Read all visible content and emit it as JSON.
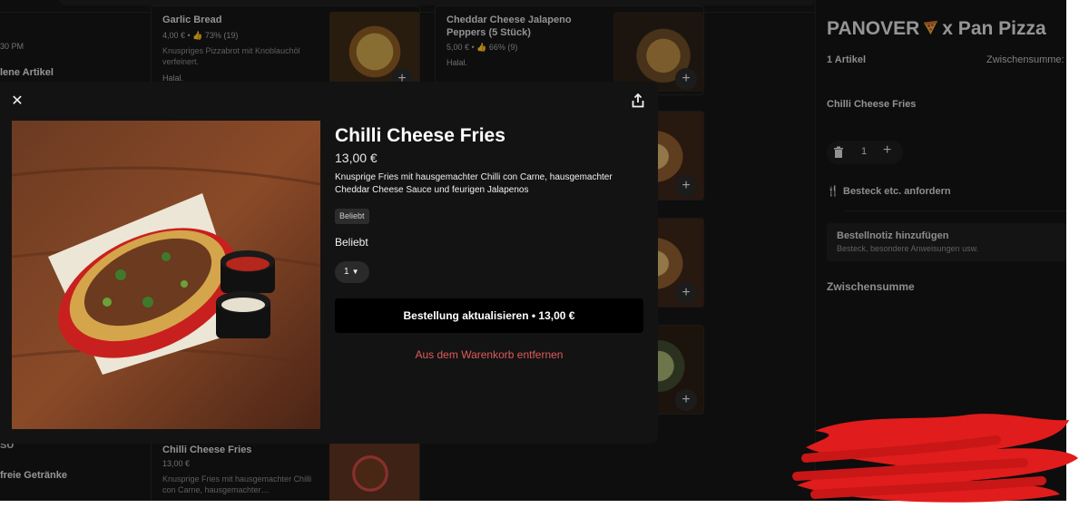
{
  "background": {
    "left_column": {
      "time_fragment": "30 PM",
      "hidden_items_fragment": "lene Artikel",
      "category_fragment_1": "SU",
      "category_fragment_2": "freie Getränke"
    },
    "menu_items": [
      {
        "name": "Garlic Bread",
        "price_rating": "4,00 € • 👍 73% (19)",
        "description": "Knuspriges Pizzabrot mit Knoblauchöl verfeinert.",
        "tag": "Halal."
      },
      {
        "name": "Cheddar Cheese Jalapeno Peppers (5 Stück)",
        "price_rating": "5,00 € • 👍 66% (9)",
        "description": "",
        "tag": "Halal."
      },
      {
        "name": "Chilli Cheese Fries",
        "price_rating": "13,00 €",
        "description": "Knusprige Fries mit hausgemachter Chilli con Carne, hausgemachter…",
        "tag": ""
      }
    ]
  },
  "cart": {
    "title_prefix": "PANOVER",
    "title_suffix": "x Pan Pizza",
    "item_count": "1 Artikel",
    "subtotal_label_top": "Zwischensumme:",
    "item_name": "Chilli Cheese Fries",
    "quantity": "1",
    "cutlery_label": "Besteck etc. anfordern",
    "note_title": "Bestellnotiz hinzufügen",
    "note_hint": "Besteck, besondere Anweisungen usw.",
    "subtotal_label": "Zwischensumme"
  },
  "modal": {
    "title": "Chilli Cheese Fries",
    "price": "13,00 €",
    "description": "Knusprige Fries mit hausgemachter Chilli con Carne, hausgemachter Cheddar Cheese Sauce und feurigen Jalapenos",
    "badge": "Beliebt",
    "section_label": "Beliebt",
    "quantity": "1",
    "update_button": "Bestellung aktualisieren • 13,00 €",
    "remove_button": "Aus dem Warenkorb entfernen"
  }
}
